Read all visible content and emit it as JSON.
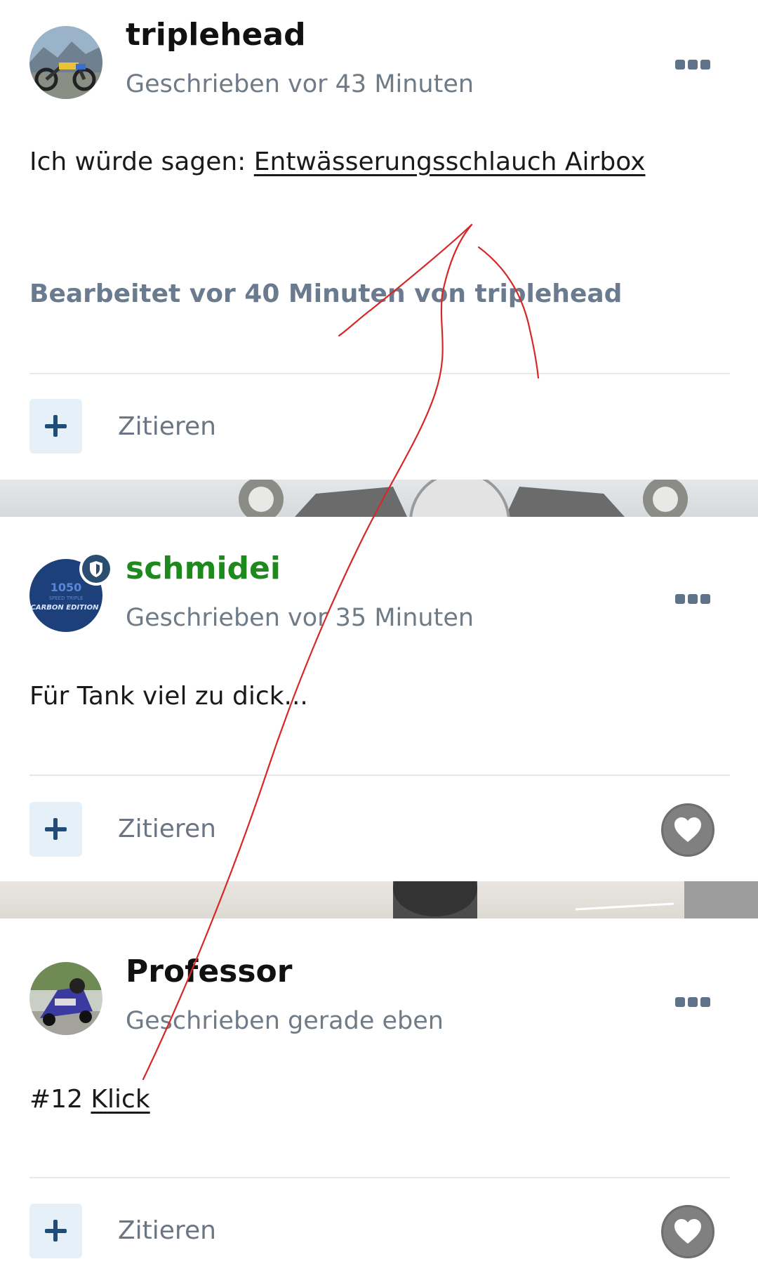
{
  "posts": [
    {
      "author": "triplehead",
      "author_color": "#111111",
      "meta": "Geschrieben vor 43 Minuten",
      "content_prefix": "Ich würde sagen: ",
      "content_link": "Entwässerungsschlauch Airbox",
      "edited": "Bearbeitet vor 40 Minuten von triplehead",
      "quote_label": "Zitieren",
      "avatar_icon": "motorcycle-avatar"
    },
    {
      "author": "schmidei",
      "author_color": "#1e8a1e",
      "meta": "Geschrieben vor 35 Minuten",
      "content": "Für Tank viel zu dick...",
      "quote_label": "Zitieren",
      "avatar_icon": "carbon-edition-avatar",
      "avatar_text_top": "1050",
      "avatar_text_mid": "SPEED TRIPLE",
      "avatar_text_bottom": "CARBON EDITION",
      "badge_icon": "moderator-shield-icon"
    },
    {
      "author": "Professor",
      "author_color": "#111111",
      "meta": "Geschrieben gerade eben",
      "content_prefix": "#12 ",
      "content_link": "Klick",
      "quote_label": "Zitieren",
      "avatar_icon": "rider-avatar"
    }
  ],
  "icons": {
    "more": "ellipsis-icon",
    "plus": "plus-icon",
    "like": "heart-icon"
  },
  "colors": {
    "accent": "#1f4d77",
    "meta_text": "#6f7b87",
    "moderator_name": "#1e8a1e",
    "annotation": "#d62828"
  }
}
